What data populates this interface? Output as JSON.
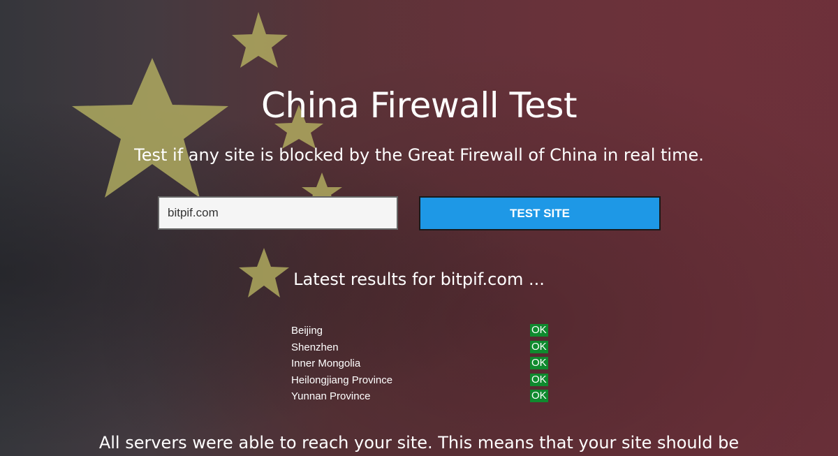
{
  "header": {
    "title": "China Firewall Test",
    "subtitle": "Test if any site is blocked by the Great Firewall of China in real time."
  },
  "search": {
    "value": "bitpif.com",
    "placeholder": "bitpif.com",
    "button_label": "TEST SITE"
  },
  "results": {
    "heading": "Latest results for bitpif.com ...",
    "rows": [
      {
        "location": "Beijing",
        "status": "OK"
      },
      {
        "location": "Shenzhen",
        "status": "OK"
      },
      {
        "location": "Inner Mongolia",
        "status": "OK"
      },
      {
        "location": "Heilongjiang Province",
        "status": "OK"
      },
      {
        "location": "Yunnan Province",
        "status": "OK"
      }
    ]
  },
  "summary": {
    "text": "All servers were able to reach your site. This means that your site should be"
  },
  "colors": {
    "button": "#1e98e6",
    "status_ok": "#0f8a2e",
    "flag_star": "#b8b563",
    "flag_red": "#6a3039"
  },
  "background": {
    "icon": "china-flag-stars-icon"
  }
}
